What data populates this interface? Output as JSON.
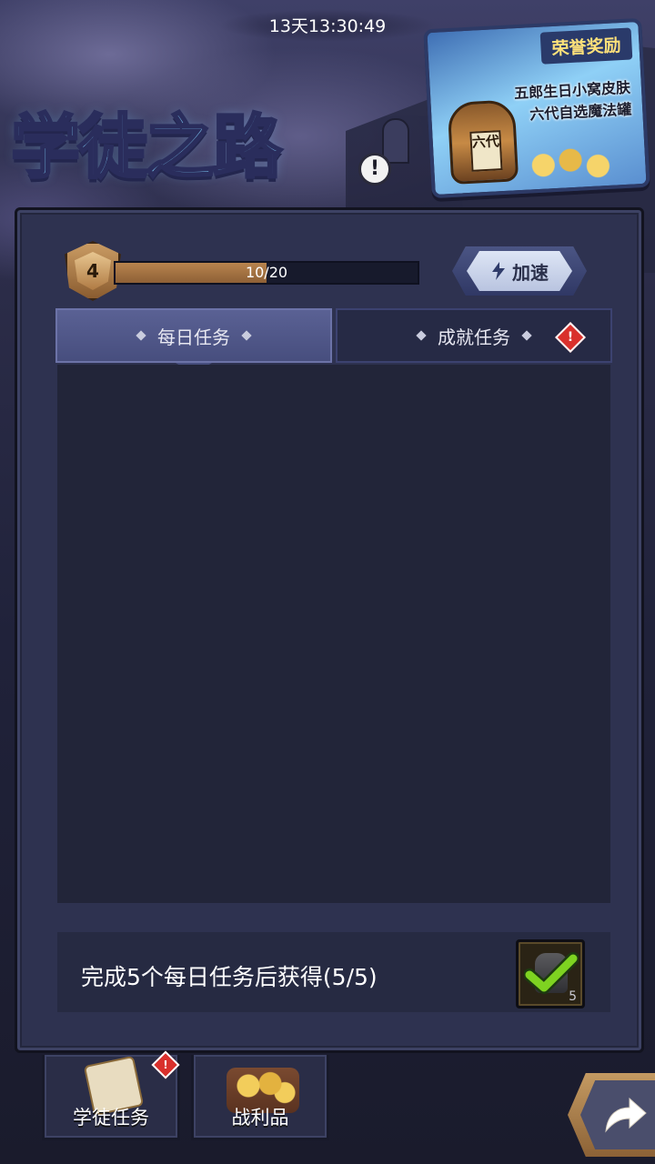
{
  "timer": "13天13:30:49",
  "title": "学徒之路",
  "reward_card": {
    "title": "荣誉奖励",
    "lines": [
      "五郎生日小窝皮肤",
      "六代自选魔法罐"
    ],
    "jar_label": "六代"
  },
  "level": {
    "value": "4",
    "progress_text": "10/20",
    "progress_fraction": 0.5
  },
  "speed_button": {
    "label": "加速"
  },
  "tabs": [
    {
      "label": "每日任务",
      "active": true
    },
    {
      "label": "成就任务",
      "alert": "!"
    }
  ],
  "daily_reward": {
    "text": "完成5个每日任务后获得(5/5)",
    "item_count": "5"
  },
  "nav": [
    {
      "label": "学徒任务",
      "alert": "!"
    },
    {
      "label": "战利品"
    }
  ],
  "colors": {
    "accent_title": "#7cc6f2",
    "progress_fill": "#b8844e",
    "alert_red": "#d9302c",
    "check_green": "#7ed321"
  }
}
